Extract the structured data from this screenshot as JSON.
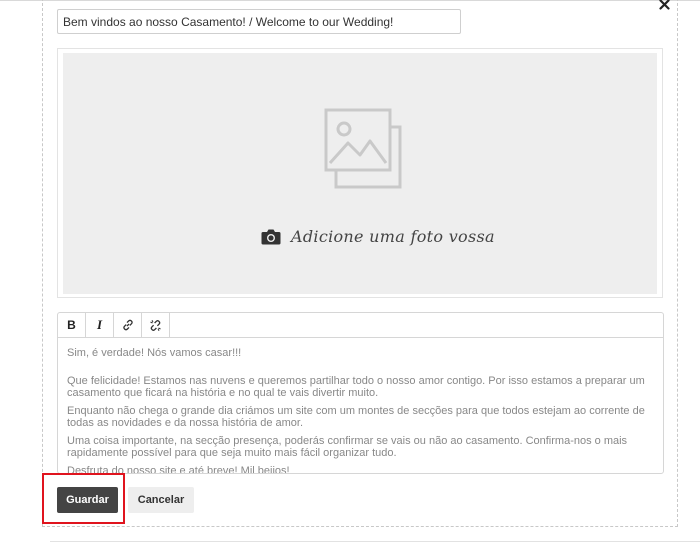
{
  "header": {
    "title_value": "Bem vindos ao nosso Casamento! / Welcome to our Wedding!"
  },
  "photo": {
    "cta_label": "Adicione uma foto vossa",
    "placeholder_icon": "image-placeholder-icon",
    "camera_icon": "camera-icon"
  },
  "toolbar": {
    "bold_label": "B",
    "italic_label": "I",
    "link_icon": "link-icon",
    "unlink_icon": "unlink-icon"
  },
  "editor": {
    "paragraphs": [
      "Sim, é verdade! Nós vamos casar!!!",
      "Que felicidade! Estamos nas nuvens e queremos partilhar todo o nosso amor contigo. Por isso estamos a preparar um casamento que ficará na história e no qual te vais divertir muito.",
      "Enquanto não chega o grande dia criámos um site com um montes de secções para que todos estejam ao corrente de todas as novidades e da nossa história de amor.",
      "Uma coisa importante, na secção presença, poderás confirmar se vais ou não ao casamento. Confirma-nos o mais rapidamente possível para que seja muito mais fácil organizar tudo.",
      "Desfruta do nosso site e até breve! Mil beijos!"
    ]
  },
  "actions": {
    "save_label": "Guardar",
    "cancel_label": "Cancelar",
    "highlight_color": "#e0141e"
  },
  "colors": {
    "save_button_bg": "#444444",
    "cancel_button_bg": "#eeeeee",
    "photo_area_bg": "#eeeeee"
  }
}
